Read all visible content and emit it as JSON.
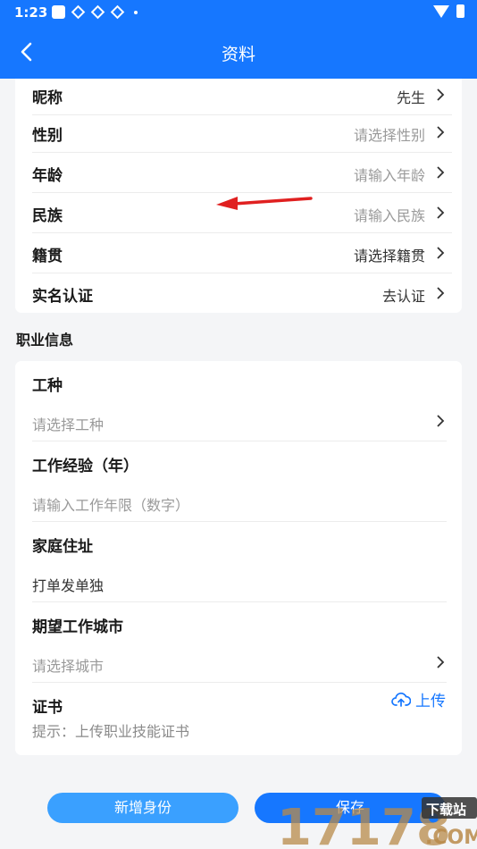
{
  "status_bar": {
    "time": "1:23"
  },
  "header": {
    "title": "资料"
  },
  "profile_rows": [
    {
      "label": "昵称",
      "value": "先生",
      "value_is_placeholder": false
    },
    {
      "label": "性别",
      "value": "请选择性别",
      "value_is_placeholder": true
    },
    {
      "label": "年龄",
      "value": "请输入年龄",
      "value_is_placeholder": true
    },
    {
      "label": "民族",
      "value": "请输入民族",
      "value_is_placeholder": true
    },
    {
      "label": "籍贯",
      "value": "请选择籍贯",
      "value_is_placeholder": false
    },
    {
      "label": "实名认证",
      "value": "去认证",
      "value_is_placeholder": false
    }
  ],
  "job_section": {
    "title": "职业信息",
    "fields": [
      {
        "label": "工种",
        "value": "请选择工种"
      },
      {
        "label": "工作经验（年）",
        "value": "请输入工作年限（数字）"
      },
      {
        "label": "家庭住址",
        "value": "打单发单独"
      },
      {
        "label": "期望工作城市",
        "value": "请选择城市"
      }
    ],
    "certificate": {
      "label": "证书",
      "upload_label": "上传",
      "hint": "提示：上传职业技能证书"
    }
  },
  "footer": {
    "new_identity_label": "新增身份",
    "save_label": "保存"
  },
  "watermark": {
    "number": "17178",
    "text": "下载站",
    "domain": ".COM"
  },
  "colors": {
    "primary": "#1677ff",
    "secondary_button": "#3aa0ff",
    "placeholder": "#9a9a9a",
    "annotation_arrow": "#e02020"
  }
}
